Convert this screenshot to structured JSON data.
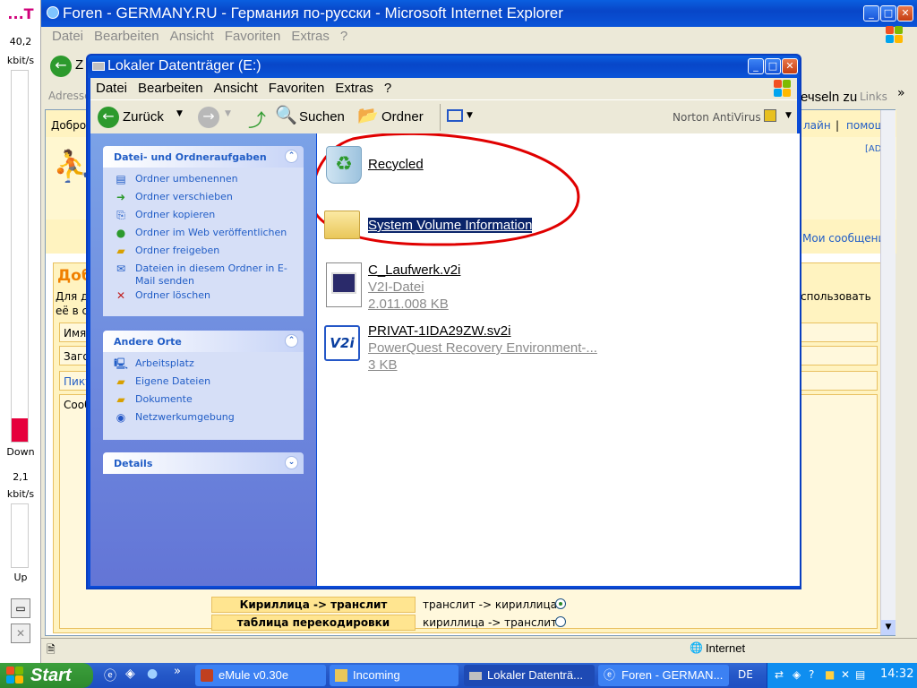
{
  "meter": {
    "top": "...T",
    "down_rate": "40,2",
    "down_unit": "kbit/s",
    "down_label": "Down",
    "up_rate": "2,1",
    "up_unit": "kbit/s",
    "up_label": "Up"
  },
  "ie": {
    "title": "Foren - GERMANY.RU - Германия по-русски - Microsoft Internet Explorer",
    "menu": [
      "Datei",
      "Bearbeiten",
      "Ansicht",
      "Favoriten",
      "Extras",
      "?"
    ],
    "back_fragment": "Z",
    "address_label": "Adresse",
    "links_partial": "ечseln zu",
    "links_label": "Links",
    "page_greeting": "Добро",
    "page_links": [
      "лайн",
      "помощь"
    ],
    "ad_tag": "[AD]",
    "my_messages": "Мои сообщения",
    "orange_heading": "Доба",
    "para_left": [
      "Для де",
      "её в с"
    ],
    "para_right": "спользовать",
    "form_labels": [
      "Имя",
      "Загол",
      "Пикто",
      "Сооб"
    ],
    "translit_rows": [
      {
        "label": "Кириллица -> транслит",
        "option": "транслит -> кириллица",
        "checked": true
      },
      {
        "label": "таблица перекодировки",
        "option": "кириллица -> транслит",
        "checked": false
      }
    ],
    "status_zone": "Internet"
  },
  "explorer": {
    "title": "Lokaler Datenträger (E:)",
    "menu": [
      "Datei",
      "Bearbeiten",
      "Ansicht",
      "Favoriten",
      "Extras",
      "?"
    ],
    "toolbar": {
      "back": "Zurück",
      "search": "Suchen",
      "folders": "Ordner",
      "norton": "Norton AntiVirus"
    },
    "file_tasks": {
      "title": "Datei- und Ordneraufgaben",
      "items": [
        "Ordner umbenennen",
        "Ordner verschieben",
        "Ordner kopieren",
        "Ordner im Web veröffentlichen",
        "Ordner freigeben",
        "Dateien in diesem Ordner in E-Mail senden",
        "Ordner löschen"
      ]
    },
    "other_places": {
      "title": "Andere Orte",
      "items": [
        "Arbeitsplatz",
        "Eigene Dateien",
        "Dokumente",
        "Netzwerkumgebung"
      ]
    },
    "details": {
      "title": "Details"
    },
    "files": [
      {
        "name": "Recycled",
        "type": "",
        "size": ""
      },
      {
        "name": "System Volume Information",
        "type": "",
        "size": ""
      },
      {
        "name": "C_Laufwerk.v2i",
        "type": "V2I-Datei",
        "size": "2.011.008 KB"
      },
      {
        "name": "PRIVAT-1IDA29ZW.sv2i",
        "type": "PowerQuest Recovery Environment-...",
        "size": "3 KB"
      }
    ],
    "v2i_icon_text": "V2i"
  },
  "taskbar": {
    "start": "Start",
    "buttons": [
      "eMule v0.30e",
      "Incoming",
      "Lokaler Datenträ...",
      "Foren - GERMAN..."
    ],
    "lang": "DE",
    "clock": "14:32"
  },
  "colors": {
    "xp_blue": "#0a54d8",
    "start_green": "#2d8a2d",
    "task_link": "#215dc6",
    "annotation_red": "#e00000"
  }
}
